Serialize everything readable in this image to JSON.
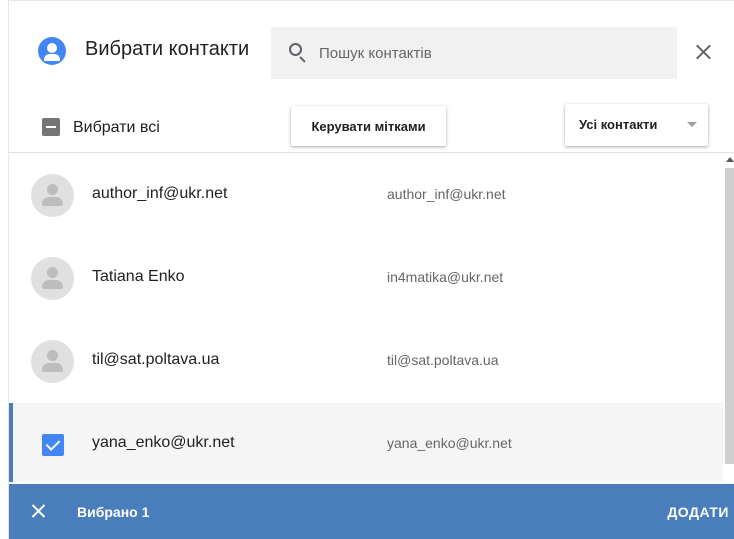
{
  "colors": {
    "accent": "#4285f4",
    "footer_bar": "#4a7dbb",
    "selected_row": "#f5f5f5"
  },
  "header": {
    "icon": "contacts-icon",
    "title": "Вибрати контакти",
    "search": {
      "icon": "search-icon",
      "placeholder": "Пошук контактів",
      "value": ""
    },
    "close_icon": "close-icon"
  },
  "toolbar": {
    "select_all_label": "Вибрати всі",
    "select_all_state": "indeterminate",
    "manage_labels_button": "Керувати мітками",
    "filter": {
      "selected": "Усі контакти",
      "icon": "dropdown-arrow-icon"
    }
  },
  "contacts": [
    {
      "name": "author_inf@ukr.net",
      "email": "author_inf@ukr.net",
      "selected": false
    },
    {
      "name": "Tatiana Enko",
      "email": "in4matika@ukr.net",
      "selected": false
    },
    {
      "name": "til@sat.poltava.ua",
      "email": "til@sat.poltava.ua",
      "selected": false
    },
    {
      "name": "yana_enko@ukr.net",
      "email": "yana_enko@ukr.net",
      "selected": true
    }
  ],
  "footer": {
    "close_icon": "close-icon",
    "selected_count_text": "Вибрано 1",
    "add_button": "ДОДАТИ"
  }
}
